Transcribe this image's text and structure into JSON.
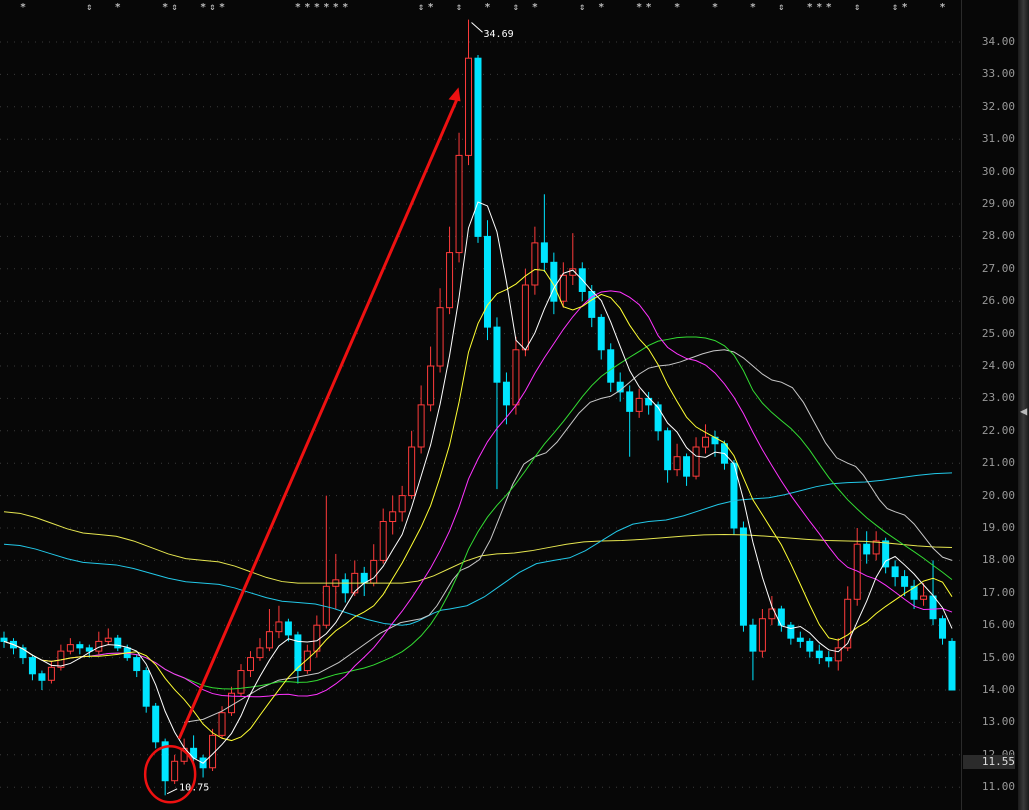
{
  "chart_data": {
    "type": "candlestick",
    "ylim": [
      10.5,
      34.8
    ],
    "y_ticks": [
      "34.00",
      "33.00",
      "32.00",
      "31.00",
      "30.00",
      "29.00",
      "28.00",
      "27.00",
      "26.00",
      "25.00",
      "24.00",
      "23.00",
      "22.00",
      "21.00",
      "20.00",
      "19.00",
      "18.00",
      "17.00",
      "16.00",
      "15.00",
      "14.00",
      "13.00",
      "12.00",
      "11.00"
    ],
    "current_price": "11.55",
    "high_label": "34.69",
    "low_label": "10.75",
    "high_index": 49,
    "low_index": 17,
    "colors": {
      "up": "#ff3b3b",
      "down": "#00e5ff",
      "ma5": "#ffffff",
      "ma10": "#ffff33",
      "ma20": "#ff33ff",
      "ma30": "#33dd33",
      "ma60": "#c8c8c8",
      "ma120": "#22c8e8",
      "ma250": "#e6e650",
      "annotation": "#ee1111"
    },
    "ohlc": [
      [
        15.6,
        15.8,
        15.3,
        15.5
      ],
      [
        15.5,
        15.6,
        15.1,
        15.3
      ],
      [
        15.3,
        15.4,
        14.8,
        15.0
      ],
      [
        15.0,
        15.1,
        14.3,
        14.5
      ],
      [
        14.5,
        14.6,
        14.0,
        14.3
      ],
      [
        14.3,
        14.9,
        14.2,
        14.7
      ],
      [
        14.7,
        15.4,
        14.6,
        15.2
      ],
      [
        15.2,
        15.6,
        15.1,
        15.4
      ],
      [
        15.4,
        15.5,
        15.1,
        15.3
      ],
      [
        15.3,
        15.4,
        15.0,
        15.2
      ],
      [
        15.2,
        15.8,
        15.1,
        15.5
      ],
      [
        15.5,
        15.9,
        15.4,
        15.6
      ],
      [
        15.6,
        15.7,
        15.2,
        15.3
      ],
      [
        15.3,
        15.4,
        14.9,
        15.0
      ],
      [
        15.0,
        15.1,
        14.4,
        14.6
      ],
      [
        14.6,
        14.7,
        13.3,
        13.5
      ],
      [
        13.5,
        13.6,
        12.2,
        12.4
      ],
      [
        12.4,
        12.5,
        10.75,
        11.2
      ],
      [
        11.2,
        12.0,
        11.1,
        11.8
      ],
      [
        11.8,
        12.5,
        11.7,
        12.2
      ],
      [
        12.2,
        12.6,
        11.8,
        11.9
      ],
      [
        11.9,
        12.0,
        11.3,
        11.6
      ],
      [
        11.6,
        12.8,
        11.5,
        12.6
      ],
      [
        12.6,
        13.5,
        12.5,
        13.3
      ],
      [
        13.3,
        14.1,
        13.2,
        13.9
      ],
      [
        13.9,
        14.8,
        13.8,
        14.6
      ],
      [
        14.6,
        15.2,
        14.4,
        15.0
      ],
      [
        15.0,
        15.6,
        14.9,
        15.3
      ],
      [
        15.3,
        16.5,
        15.2,
        15.8
      ],
      [
        15.8,
        16.6,
        15.6,
        16.1
      ],
      [
        16.1,
        16.2,
        15.5,
        15.7
      ],
      [
        15.7,
        15.8,
        14.2,
        14.6
      ],
      [
        14.6,
        15.4,
        14.5,
        15.2
      ],
      [
        15.2,
        16.3,
        15.0,
        16.0
      ],
      [
        16.0,
        20.0,
        15.9,
        17.2
      ],
      [
        17.2,
        18.2,
        16.5,
        17.4
      ],
      [
        17.4,
        17.6,
        16.7,
        17.0
      ],
      [
        17.0,
        18.0,
        16.9,
        17.6
      ],
      [
        17.6,
        17.8,
        16.9,
        17.3
      ],
      [
        17.3,
        18.5,
        17.2,
        18.0
      ],
      [
        18.0,
        19.6,
        17.9,
        19.2
      ],
      [
        19.2,
        20.0,
        18.8,
        19.5
      ],
      [
        19.5,
        20.3,
        19.2,
        20.0
      ],
      [
        20.0,
        22.0,
        19.9,
        21.5
      ],
      [
        21.5,
        23.4,
        21.3,
        22.8
      ],
      [
        22.8,
        24.6,
        22.6,
        24.0
      ],
      [
        24.0,
        26.4,
        23.8,
        25.8
      ],
      [
        25.8,
        28.3,
        25.6,
        27.5
      ],
      [
        27.5,
        31.2,
        27.2,
        30.5
      ],
      [
        30.5,
        34.69,
        30.2,
        33.5
      ],
      [
        33.5,
        33.6,
        27.8,
        28.0
      ],
      [
        28.0,
        28.5,
        24.8,
        25.2
      ],
      [
        25.2,
        25.5,
        20.2,
        23.5
      ],
      [
        23.5,
        23.8,
        22.2,
        22.8
      ],
      [
        22.8,
        24.9,
        22.5,
        24.5
      ],
      [
        24.5,
        27.0,
        24.3,
        26.5
      ],
      [
        26.5,
        28.3,
        26.2,
        27.8
      ],
      [
        27.8,
        29.3,
        26.9,
        27.2
      ],
      [
        27.2,
        27.5,
        25.6,
        26.0
      ],
      [
        26.0,
        27.2,
        25.8,
        26.8
      ],
      [
        26.8,
        28.1,
        26.5,
        27.0
      ],
      [
        27.0,
        27.2,
        26.0,
        26.3
      ],
      [
        26.3,
        26.5,
        25.2,
        25.5
      ],
      [
        25.5,
        25.6,
        24.2,
        24.5
      ],
      [
        24.5,
        24.7,
        23.2,
        23.5
      ],
      [
        23.5,
        23.8,
        22.9,
        23.2
      ],
      [
        23.2,
        23.4,
        21.2,
        22.6
      ],
      [
        22.6,
        23.3,
        22.4,
        23.0
      ],
      [
        23.0,
        23.2,
        22.5,
        22.8
      ],
      [
        22.8,
        22.9,
        21.7,
        22.0
      ],
      [
        22.0,
        22.1,
        20.4,
        20.8
      ],
      [
        20.8,
        21.6,
        20.6,
        21.2
      ],
      [
        21.2,
        21.3,
        20.3,
        20.6
      ],
      [
        20.6,
        21.8,
        20.5,
        21.5
      ],
      [
        21.5,
        22.2,
        21.3,
        21.8
      ],
      [
        21.8,
        22.0,
        21.2,
        21.6
      ],
      [
        21.6,
        21.7,
        20.8,
        21.0
      ],
      [
        21.0,
        21.1,
        18.8,
        19.0
      ],
      [
        19.0,
        19.2,
        15.8,
        16.0
      ],
      [
        16.0,
        16.2,
        14.3,
        15.2
      ],
      [
        15.2,
        16.5,
        15.0,
        16.2
      ],
      [
        16.2,
        16.9,
        16.0,
        16.5
      ],
      [
        16.5,
        16.6,
        15.8,
        16.0
      ],
      [
        16.0,
        16.1,
        15.4,
        15.6
      ],
      [
        15.6,
        15.8,
        15.3,
        15.5
      ],
      [
        15.5,
        15.6,
        15.0,
        15.2
      ],
      [
        15.2,
        15.4,
        14.8,
        15.0
      ],
      [
        15.0,
        15.2,
        14.7,
        14.9
      ],
      [
        14.9,
        15.6,
        14.6,
        15.3
      ],
      [
        15.3,
        17.2,
        15.2,
        16.8
      ],
      [
        16.8,
        19.0,
        16.6,
        18.5
      ],
      [
        18.5,
        18.9,
        17.9,
        18.2
      ],
      [
        18.2,
        18.9,
        18.0,
        18.6
      ],
      [
        18.6,
        18.7,
        17.6,
        17.8
      ],
      [
        17.8,
        18.0,
        17.2,
        17.5
      ],
      [
        17.5,
        17.7,
        16.9,
        17.2
      ],
      [
        17.2,
        17.4,
        16.5,
        16.8
      ],
      [
        16.8,
        17.3,
        16.6,
        16.9
      ],
      [
        16.9,
        18.0,
        16.0,
        16.2
      ],
      [
        16.2,
        16.3,
        15.4,
        15.6
      ],
      [
        15.5,
        15.6,
        14.0,
        14.0
      ]
    ],
    "ma_long": {
      "ma60": [
        [
          19,
          13.0
        ],
        [
          31,
          14.4
        ],
        [
          44,
          16.2
        ],
        [
          49,
          17.8
        ],
        [
          56,
          21.2
        ],
        [
          63,
          23.0
        ],
        [
          69,
          24.0
        ],
        [
          76,
          24.5
        ],
        [
          82,
          23.5
        ],
        [
          89,
          21.0
        ],
        [
          94,
          19.5
        ],
        [
          100,
          18.0
        ]
      ],
      "ma120": [
        [
          0,
          18.5
        ],
        [
          10,
          17.9
        ],
        [
          21,
          17.3
        ],
        [
          31,
          16.7
        ],
        [
          42,
          16.0
        ],
        [
          47,
          16.5
        ],
        [
          58,
          18.0
        ],
        [
          68,
          19.2
        ],
        [
          79,
          19.9
        ],
        [
          89,
          20.4
        ],
        [
          100,
          20.7
        ]
      ],
      "ma250": [
        [
          0,
          19.5
        ],
        [
          10,
          18.8
        ],
        [
          21,
          18.0
        ],
        [
          31,
          17.3
        ],
        [
          42,
          17.3
        ],
        [
          52,
          18.2
        ],
        [
          63,
          18.6
        ],
        [
          76,
          18.8
        ],
        [
          89,
          18.6
        ],
        [
          100,
          18.4
        ]
      ]
    },
    "event_markers": [
      {
        "i": 2,
        "s": "*"
      },
      {
        "i": 9,
        "s": "⇕"
      },
      {
        "i": 12,
        "s": "*"
      },
      {
        "i": 17,
        "s": "*"
      },
      {
        "i": 18,
        "s": "⇕"
      },
      {
        "i": 21,
        "s": "*"
      },
      {
        "i": 22,
        "s": "⇕"
      },
      {
        "i": 23,
        "s": "*"
      },
      {
        "i": 31,
        "s": "*"
      },
      {
        "i": 32,
        "s": "*"
      },
      {
        "i": 33,
        "s": "*"
      },
      {
        "i": 34,
        "s": "*"
      },
      {
        "i": 35,
        "s": "*"
      },
      {
        "i": 36,
        "s": "*"
      },
      {
        "i": 44,
        "s": "⇕"
      },
      {
        "i": 45,
        "s": "*"
      },
      {
        "i": 48,
        "s": "⇕"
      },
      {
        "i": 51,
        "s": "*"
      },
      {
        "i": 54,
        "s": "⇕"
      },
      {
        "i": 56,
        "s": "*"
      },
      {
        "i": 61,
        "s": "⇕"
      },
      {
        "i": 63,
        "s": "*"
      },
      {
        "i": 67,
        "s": "*"
      },
      {
        "i": 68,
        "s": "*"
      },
      {
        "i": 71,
        "s": "*"
      },
      {
        "i": 75,
        "s": "*"
      },
      {
        "i": 79,
        "s": "*"
      },
      {
        "i": 82,
        "s": "⇕"
      },
      {
        "i": 85,
        "s": "*"
      },
      {
        "i": 86,
        "s": "*"
      },
      {
        "i": 87,
        "s": "*"
      },
      {
        "i": 90,
        "s": "⇕"
      },
      {
        "i": 94,
        "s": "⇕"
      },
      {
        "i": 95,
        "s": "*"
      },
      {
        "i": 99,
        "s": "*"
      }
    ]
  }
}
